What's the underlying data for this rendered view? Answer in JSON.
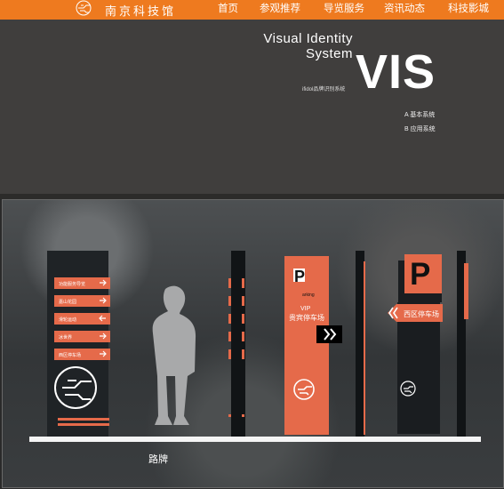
{
  "nav": {
    "brand": "南京科技馆",
    "items": [
      "首页",
      "参观推荐",
      "导览服务",
      "资讯动态",
      "科技影城"
    ]
  },
  "hero": {
    "title_line1": "Visual Identity",
    "title_line2": "System",
    "subtitle": "ifidol品牌识别系统",
    "vis": "VIS",
    "menu_a": "A 基本系统",
    "menu_b": "B 应用系统"
  },
  "board": {
    "signs": [
      "功能服务导览",
      "嘉山花园",
      "滑轮运动",
      "冰世界",
      "西区停车场"
    ],
    "parking_word": "arking",
    "vip": "VIP",
    "vip_lot": "贵宾停车场",
    "west_lot": "西区停车场",
    "parking_letter": "P"
  },
  "caption": "路牌",
  "colors": {
    "accent": "#e56a4a",
    "nav": "#ee7a1f",
    "dark_panel": "#403e3d"
  }
}
